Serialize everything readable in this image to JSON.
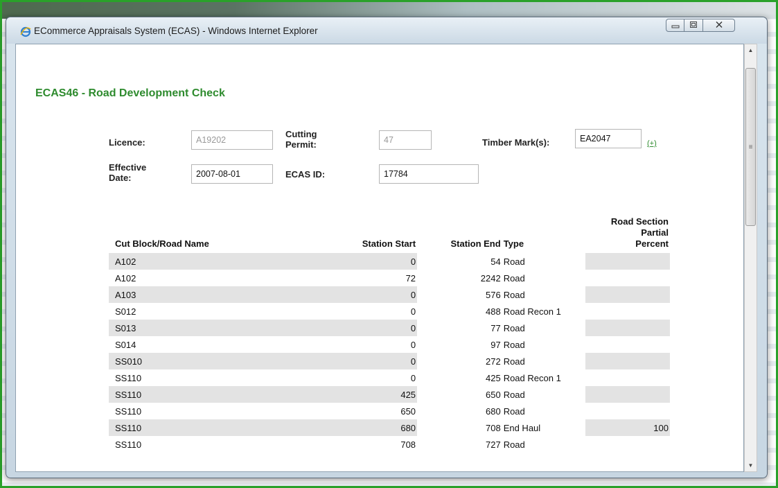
{
  "window": {
    "title": "ECommerce Appraisals System (ECAS) - Windows Internet Explorer"
  },
  "page": {
    "title": "ECAS46 - Road Development Check"
  },
  "form": {
    "licence_label": "Licence:",
    "licence_value": "A19202",
    "cutting_permit_label_1": "Cutting",
    "cutting_permit_label_2": "Permit:",
    "cutting_permit_value": "47",
    "timber_mark_label": "Timber Mark(s):",
    "timber_mark_value": "EA2047",
    "timber_mark_add": "(+)",
    "effective_date_label_1": "Effective",
    "effective_date_label_2": "Date:",
    "effective_date_value": "2007-08-01",
    "ecas_id_label": "ECAS ID:",
    "ecas_id_value": "17784"
  },
  "table": {
    "headers": {
      "name": "Cut Block/Road Name",
      "station_start": "Station Start",
      "station_end": "Station End",
      "type": "Type",
      "partial_1": "Road Section",
      "partial_2": "Partial",
      "partial_3": "Percent"
    },
    "rows": [
      {
        "name": "A102",
        "start": "0",
        "end": "54",
        "type": "Road",
        "percent": ""
      },
      {
        "name": "A102",
        "start": "72",
        "end": "2242",
        "type": "Road",
        "percent": ""
      },
      {
        "name": "A103",
        "start": "0",
        "end": "576",
        "type": "Road",
        "percent": ""
      },
      {
        "name": "S012",
        "start": "0",
        "end": "488",
        "type": "Road Recon 1",
        "percent": ""
      },
      {
        "name": "S013",
        "start": "0",
        "end": "77",
        "type": "Road",
        "percent": ""
      },
      {
        "name": "S014",
        "start": "0",
        "end": "97",
        "type": "Road",
        "percent": ""
      },
      {
        "name": "SS010",
        "start": "0",
        "end": "272",
        "type": "Road",
        "percent": ""
      },
      {
        "name": "SS110",
        "start": "0",
        "end": "425",
        "type": "Road Recon 1",
        "percent": ""
      },
      {
        "name": "SS110",
        "start": "425",
        "end": "650",
        "type": "Road",
        "percent": ""
      },
      {
        "name": "SS110",
        "start": "650",
        "end": "680",
        "type": "Road",
        "percent": ""
      },
      {
        "name": "SS110",
        "start": "680",
        "end": "708",
        "type": "End Haul",
        "percent": "100"
      },
      {
        "name": "SS110",
        "start": "708",
        "end": "727",
        "type": "Road",
        "percent": ""
      }
    ]
  },
  "icons": {
    "browser": "ie-logo-icon",
    "minimize": "minimize-icon",
    "maximize": "maximize-icon",
    "close": "close-icon",
    "scroll_up": "scroll-up-arrow-icon",
    "scroll_down": "scroll-down-arrow-icon"
  },
  "colors": {
    "accent_green": "#2e8b2e",
    "frame_green": "#2aa12a",
    "row_shade": "#e3e3e3"
  }
}
